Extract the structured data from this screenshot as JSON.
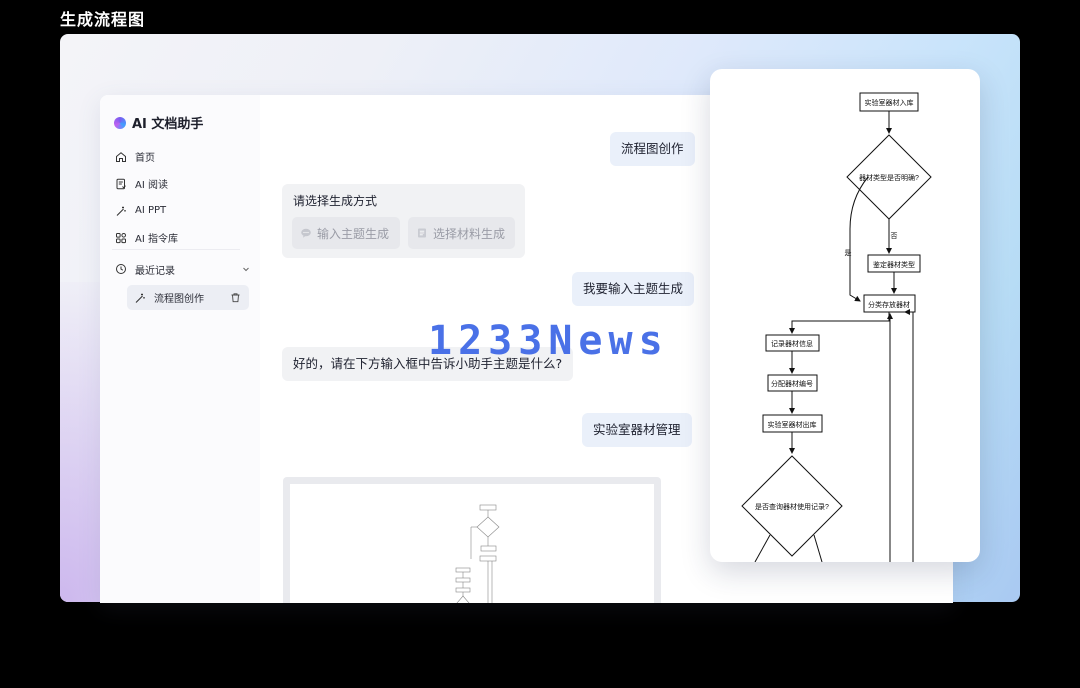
{
  "page_title": "生成流程图",
  "app": {
    "name": "AI 文档助手",
    "nav": [
      {
        "label": "首页",
        "icon": "home-icon"
      },
      {
        "label": "AI 阅读",
        "icon": "document-read-icon"
      },
      {
        "label": "AI PPT",
        "icon": "magic-wand-icon"
      },
      {
        "label": "AI 指令库",
        "icon": "command-library-icon"
      }
    ],
    "recent_label": "最近记录",
    "history_item": "流程图创作"
  },
  "chat": {
    "msg1": "流程图创作",
    "choice_title": "请选择生成方式",
    "option_topic": "输入主题生成",
    "option_material": "选择材料生成",
    "msg2": "我要输入主题生成",
    "reply": "好的，请在下方输入框中告诉小助手主题是什么?",
    "msg3": "实验室器材管理"
  },
  "flowchart": {
    "nodes": {
      "start": "实验室器材入库",
      "decision1": "器材类型是否明确?",
      "define_type": "鉴定器材类型",
      "classify": "分类存放器材",
      "record_info": "记录器材信息",
      "assign_number": "分配器材编号",
      "checkout": "实验室器材出库",
      "decision2": "是否查询器材使用记录?"
    },
    "edge_labels": {
      "yes": "是",
      "no": "否"
    }
  },
  "watermark": "1233News"
}
